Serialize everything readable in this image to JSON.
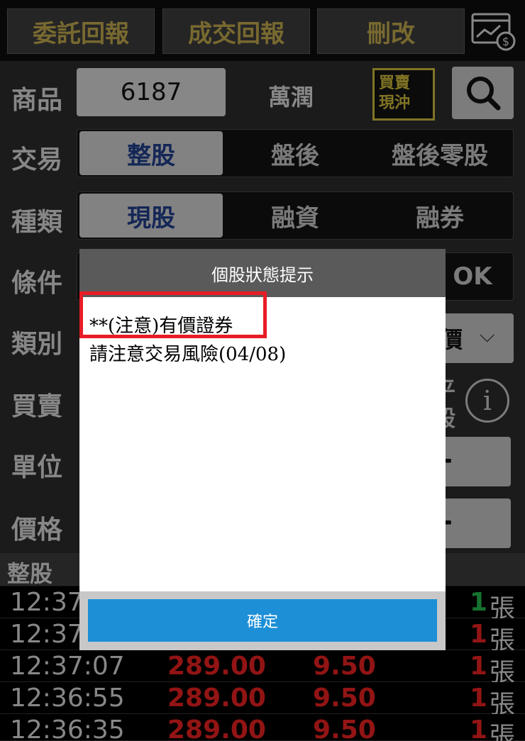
{
  "top_tabs": [
    {
      "label": "委託回報"
    },
    {
      "label": "成交回報"
    },
    {
      "label": "刪改"
    }
  ],
  "form": {
    "labels": {
      "product": "商品",
      "trade": "交易",
      "type": "種類",
      "condition": "條件",
      "category": "類別",
      "side": "買賣",
      "unit": "單位",
      "price": "價格"
    },
    "symbol": "6187",
    "stock_name": "萬潤",
    "day_trade_button": {
      "line1": "買賣",
      "line2": "現沖"
    },
    "trade_options": [
      "整股",
      "盤後",
      "盤後零股"
    ],
    "trade_selected": "整股",
    "type_options": [
      "現股",
      "融資",
      "融券"
    ],
    "type_selected": "現股",
    "condition_partial": "OK",
    "category_partial": "價",
    "side_partial_line1": "平",
    "side_partial_line2": "般",
    "unit_partial": "-",
    "price_partial": "-"
  },
  "trade_list": {
    "header": "整股",
    "rows": [
      {
        "time": "12:37",
        "price": "",
        "change": "",
        "qty": "1",
        "qty_color": "#22b04a",
        "unit": "張"
      },
      {
        "time": "12:37",
        "price": "",
        "change": "",
        "qty": "1",
        "qty_color": "#e02020",
        "unit": "張"
      },
      {
        "time": "12:37:07",
        "price": "289.00",
        "change": "9.50",
        "qty": "1",
        "qty_color": "#e02020",
        "unit": "張"
      },
      {
        "time": "12:36:55",
        "price": "289.00",
        "change": "9.50",
        "qty": "1",
        "qty_color": "#e02020",
        "unit": "張"
      },
      {
        "time": "12:36:35",
        "price": "289.00",
        "change": "9.50",
        "qty": "1",
        "qty_color": "#e02020",
        "unit": "張"
      }
    ]
  },
  "dialog": {
    "title": "個股狀態提示",
    "line1": "**(注意)有價證券",
    "line2": "請注意交易風險(04/08)",
    "ok_label": "確定"
  }
}
